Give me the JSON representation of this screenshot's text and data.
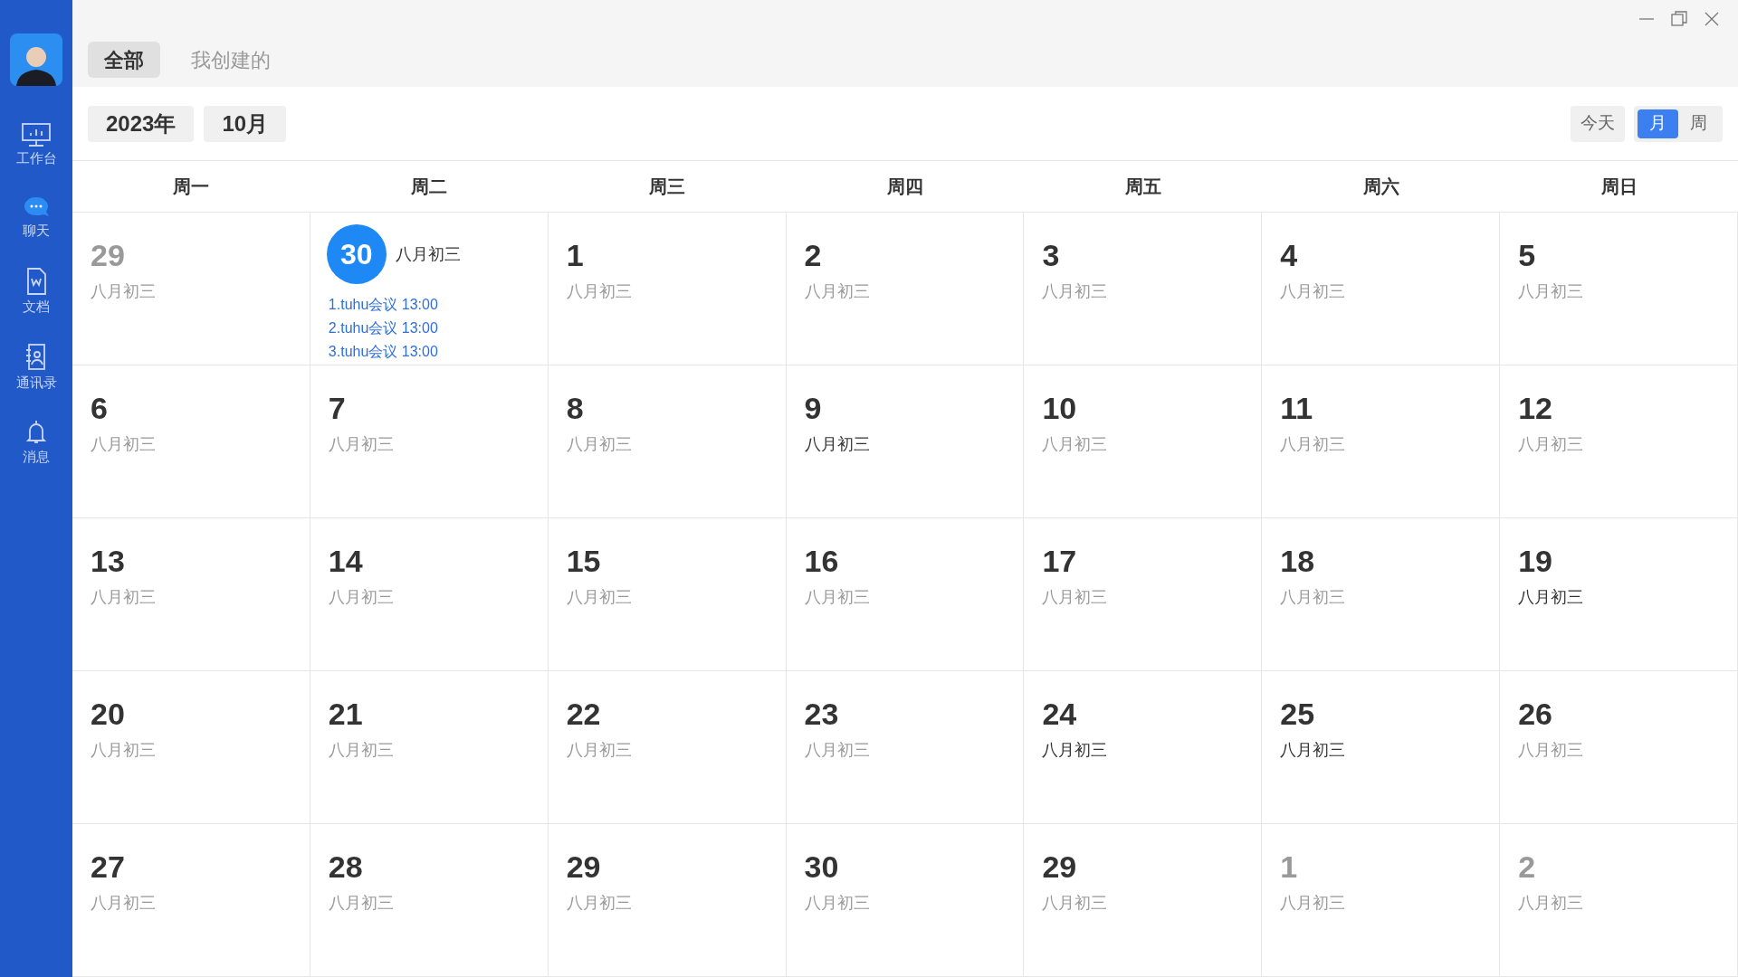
{
  "sidebar": {
    "items": [
      {
        "kind": "workbench",
        "label": "工作台"
      },
      {
        "kind": "chat",
        "label": "聊天"
      },
      {
        "kind": "docs",
        "label": "文档"
      },
      {
        "kind": "contacts",
        "label": "通讯录"
      },
      {
        "kind": "messages",
        "label": "消息"
      }
    ]
  },
  "tabs": [
    {
      "label": "全部",
      "selected": true
    },
    {
      "label": "我创建的",
      "selected": false
    }
  ],
  "toolbar": {
    "year": "2023年",
    "month": "10月",
    "today": "今天",
    "views": [
      {
        "label": "月",
        "selected": true
      },
      {
        "label": "周",
        "selected": false
      }
    ]
  },
  "weekdays": [
    "周一",
    "周二",
    "周三",
    "周四",
    "周五",
    "周六",
    "周日"
  ],
  "days": [
    {
      "day": "29",
      "lunar": "八月初三",
      "in_month": false,
      "today": false,
      "emphasized": false
    },
    {
      "day": "30",
      "lunar": "八月初三",
      "in_month": true,
      "today": true,
      "emphasized": true,
      "events": [
        "1.tuhu会议 13:00",
        "2.tuhu会议 13:00",
        "3.tuhu会议 13:00"
      ]
    },
    {
      "day": "1",
      "lunar": "八月初三",
      "in_month": true,
      "today": false,
      "emphasized": false
    },
    {
      "day": "2",
      "lunar": "八月初三",
      "in_month": true,
      "today": false,
      "emphasized": false
    },
    {
      "day": "3",
      "lunar": "八月初三",
      "in_month": true,
      "today": false,
      "emphasized": false
    },
    {
      "day": "4",
      "lunar": "八月初三",
      "in_month": true,
      "today": false,
      "emphasized": false
    },
    {
      "day": "5",
      "lunar": "八月初三",
      "in_month": true,
      "today": false,
      "emphasized": false
    },
    {
      "day": "6",
      "lunar": "八月初三",
      "in_month": true,
      "today": false,
      "emphasized": false
    },
    {
      "day": "7",
      "lunar": "八月初三",
      "in_month": true,
      "today": false,
      "emphasized": false
    },
    {
      "day": "8",
      "lunar": "八月初三",
      "in_month": true,
      "today": false,
      "emphasized": false
    },
    {
      "day": "9",
      "lunar": "八月初三",
      "in_month": true,
      "today": false,
      "emphasized": true
    },
    {
      "day": "10",
      "lunar": "八月初三",
      "in_month": true,
      "today": false,
      "emphasized": false
    },
    {
      "day": "11",
      "lunar": "八月初三",
      "in_month": true,
      "today": false,
      "emphasized": false
    },
    {
      "day": "12",
      "lunar": "八月初三",
      "in_month": true,
      "today": false,
      "emphasized": false
    },
    {
      "day": "13",
      "lunar": "八月初三",
      "in_month": true,
      "today": false,
      "emphasized": false
    },
    {
      "day": "14",
      "lunar": "八月初三",
      "in_month": true,
      "today": false,
      "emphasized": false
    },
    {
      "day": "15",
      "lunar": "八月初三",
      "in_month": true,
      "today": false,
      "emphasized": false
    },
    {
      "day": "16",
      "lunar": "八月初三",
      "in_month": true,
      "today": false,
      "emphasized": false
    },
    {
      "day": "17",
      "lunar": "八月初三",
      "in_month": true,
      "today": false,
      "emphasized": false
    },
    {
      "day": "18",
      "lunar": "八月初三",
      "in_month": true,
      "today": false,
      "emphasized": false
    },
    {
      "day": "19",
      "lunar": "八月初三",
      "in_month": true,
      "today": false,
      "emphasized": true
    },
    {
      "day": "20",
      "lunar": "八月初三",
      "in_month": true,
      "today": false,
      "emphasized": false
    },
    {
      "day": "21",
      "lunar": "八月初三",
      "in_month": true,
      "today": false,
      "emphasized": false
    },
    {
      "day": "22",
      "lunar": "八月初三",
      "in_month": true,
      "today": false,
      "emphasized": false
    },
    {
      "day": "23",
      "lunar": "八月初三",
      "in_month": true,
      "today": false,
      "emphasized": false
    },
    {
      "day": "24",
      "lunar": "八月初三",
      "in_month": true,
      "today": false,
      "emphasized": true
    },
    {
      "day": "25",
      "lunar": "八月初三",
      "in_month": true,
      "today": false,
      "emphasized": true
    },
    {
      "day": "26",
      "lunar": "八月初三",
      "in_month": true,
      "today": false,
      "emphasized": false
    },
    {
      "day": "27",
      "lunar": "八月初三",
      "in_month": true,
      "today": false,
      "emphasized": false
    },
    {
      "day": "28",
      "lunar": "八月初三",
      "in_month": true,
      "today": false,
      "emphasized": false
    },
    {
      "day": "29",
      "lunar": "八月初三",
      "in_month": true,
      "today": false,
      "emphasized": false
    },
    {
      "day": "30",
      "lunar": "八月初三",
      "in_month": true,
      "today": false,
      "emphasized": false
    },
    {
      "day": "29",
      "lunar": "八月初三",
      "in_month": true,
      "today": false,
      "emphasized": false
    },
    {
      "day": "1",
      "lunar": "八月初三",
      "in_month": false,
      "today": false,
      "emphasized": false
    },
    {
      "day": "2",
      "lunar": "八月初三",
      "in_month": false,
      "today": false,
      "emphasized": false
    }
  ]
}
